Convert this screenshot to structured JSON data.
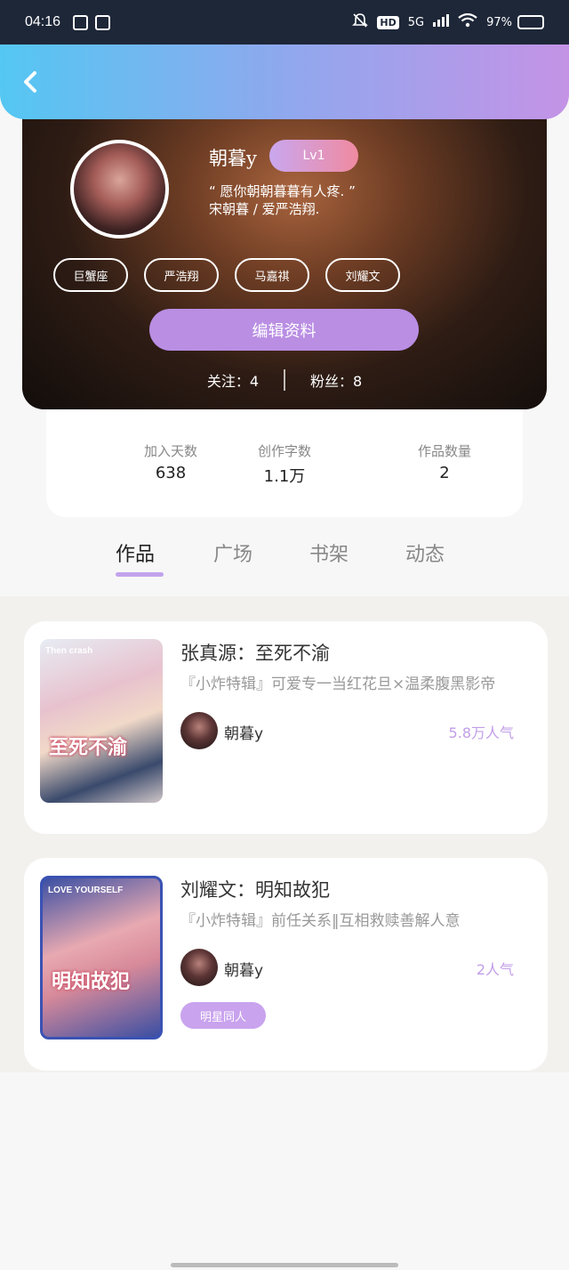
{
  "status_bar": {
    "time": "04:16",
    "network": "5G",
    "hd": "HD",
    "battery": "97%",
    "battery_level": 0.97
  },
  "header": {
    "back_icon": "chevron-left-icon"
  },
  "profile": {
    "nickname": "朝暮y",
    "level": "Lv1",
    "bio_line1": "“ 愿你朝朝暮暮有人疼. ”",
    "bio_line2": "宋朝暮 / 爱严浩翔.",
    "tags": [
      "巨蟹座",
      "严浩翔",
      "马嘉祺",
      "刘耀文"
    ],
    "edit_button": "编辑资料",
    "following_label": "关注：4",
    "fans_label": "粉丝：8"
  },
  "stats": [
    {
      "label": "加入天数",
      "value": "638"
    },
    {
      "label": "创作字数",
      "value": "1.1万"
    },
    {
      "label": "作品数量",
      "value": "2"
    }
  ],
  "tabs": [
    "作品",
    "广场",
    "书架",
    "动态"
  ],
  "works": [
    {
      "title": "张真源：至死不渝",
      "desc": "『小炸特辑』可爱专一当红花旦×温柔腹黑影帝",
      "author": "朝暮y",
      "popularity": "5.8万人气",
      "cover_text": "至死不渝",
      "cover_top": "Then crash",
      "genre": ""
    },
    {
      "title": "刘耀文：明知故犯",
      "desc": "『小炸特辑』前任关系‖互相救赎善解人意",
      "author": "朝暮y",
      "popularity": "2人气",
      "cover_text": "明知故犯",
      "cover_top": "LOVE YOURSELF",
      "genre": "明星同人"
    }
  ]
}
